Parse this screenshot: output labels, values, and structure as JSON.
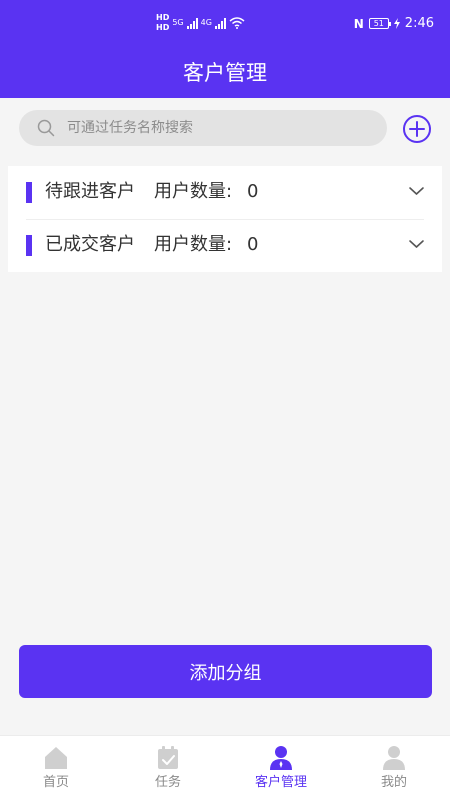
{
  "status_bar": {
    "hd1": "HD",
    "hd2": "HD",
    "net1": "5G",
    "net2": "4G",
    "battery": "51",
    "time": "2:46"
  },
  "header": {
    "title": "客户管理"
  },
  "search": {
    "placeholder": "可通过任务名称搜索",
    "value": ""
  },
  "groups": [
    {
      "name": "待跟进客户",
      "count_label": "用户数量:",
      "count": "0"
    },
    {
      "name": "已成交客户",
      "count_label": "用户数量:",
      "count": "0"
    }
  ],
  "add_group_label": "添加分组",
  "tabs": [
    {
      "label": "首页",
      "icon": "home-icon",
      "active": false
    },
    {
      "label": "任务",
      "icon": "task-icon",
      "active": false
    },
    {
      "label": "客户管理",
      "icon": "customer-icon",
      "active": true
    },
    {
      "label": "我的",
      "icon": "profile-icon",
      "active": false
    }
  ],
  "colors": {
    "primary": "#5a33f2",
    "inactive": "#8a8a8a",
    "background": "#f5f5f5"
  }
}
